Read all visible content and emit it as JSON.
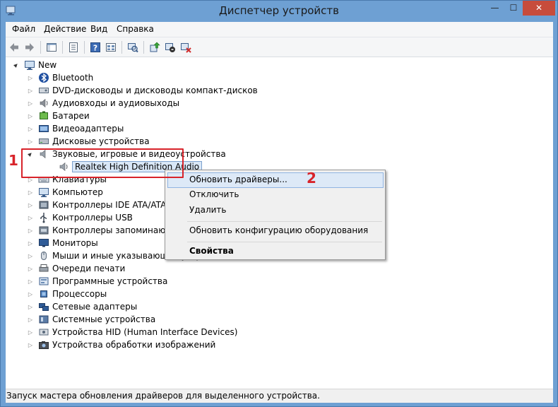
{
  "window": {
    "title": "Диспетчер устройств",
    "min_glyph": "—",
    "max_glyph": "☐",
    "close_glyph": "✕"
  },
  "menubar": [
    "Файл",
    "Действие",
    "Вид",
    "Справка"
  ],
  "toolbar": {
    "icons": [
      "back-icon",
      "forward-icon",
      "show-hide-tree-icon",
      "properties-icon",
      "help-icon",
      "view-icon",
      "scan-hardware-icon",
      "update-driver-icon",
      "disable-device-icon",
      "uninstall-device-icon"
    ]
  },
  "tree": {
    "root": "New",
    "categories": [
      {
        "label": "Bluetooth",
        "icon": "bluetooth-icon"
      },
      {
        "label": "DVD-дисководы и дисководы компакт-дисков",
        "icon": "dvd-drive-icon"
      },
      {
        "label": "Аудиовходы и аудиовыходы",
        "icon": "audio-io-icon"
      },
      {
        "label": "Батареи",
        "icon": "battery-icon"
      },
      {
        "label": "Видеоадаптеры",
        "icon": "display-adapter-icon"
      },
      {
        "label": "Дисковые устройства",
        "icon": "disk-drive-icon"
      },
      {
        "label": "Звуковые, игровые и видеоустройства",
        "icon": "sound-icon",
        "expanded": true
      },
      {
        "label": "Клавиатуры",
        "icon": "keyboard-icon"
      },
      {
        "label": "Компьютер",
        "icon": "computer-icon"
      },
      {
        "label": "Контроллеры IDE ATA/ATAPI",
        "icon": "ide-controller-icon"
      },
      {
        "label": "Контроллеры USB",
        "icon": "usb-controller-icon"
      },
      {
        "label": "Контроллеры запоминающих устройств",
        "icon": "storage-controller-icon"
      },
      {
        "label": "Мониторы",
        "icon": "monitor-icon"
      },
      {
        "label": "Мыши и иные указывающие устройства",
        "icon": "mouse-icon"
      },
      {
        "label": "Очереди печати",
        "icon": "print-queue-icon"
      },
      {
        "label": "Программные устройства",
        "icon": "software-device-icon"
      },
      {
        "label": "Процессоры",
        "icon": "processor-icon"
      },
      {
        "label": "Сетевые адаптеры",
        "icon": "network-adapter-icon"
      },
      {
        "label": "Системные устройства",
        "icon": "system-device-icon"
      },
      {
        "label": "Устройства HID (Human Interface Devices)",
        "icon": "hid-icon"
      },
      {
        "label": "Устройства обработки изображений",
        "icon": "imaging-device-icon"
      }
    ],
    "child": {
      "label": "Realtek High Definition Audio",
      "icon": "speaker-icon"
    }
  },
  "context_menu": {
    "items": [
      {
        "label": "Обновить драйверы...",
        "highlighted": true
      },
      {
        "label": "Отключить"
      },
      {
        "label": "Удалить"
      },
      {
        "label": "Обновить конфигурацию оборудования"
      },
      {
        "label": "Свойства",
        "bold": true
      }
    ]
  },
  "annotations": {
    "step1": "1",
    "step2": "2"
  },
  "status": {
    "text": "Запуск мастера обновления драйверов для выделенного устройства."
  },
  "colors": {
    "frame": "#6ea0d3",
    "highlight": "#dde9f7",
    "annotation": "#d8232a",
    "close": "#c74c3c"
  }
}
